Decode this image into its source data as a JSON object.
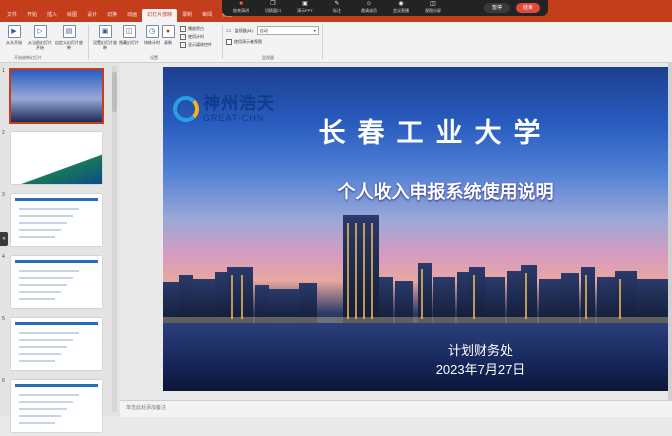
{
  "tabs": [
    "文件",
    "开始",
    "插入",
    "绘图",
    "设计",
    "切换",
    "动画",
    "幻灯片放映",
    "录制",
    "审阅",
    "视图"
  ],
  "active_tab_index": 7,
  "meeting_toolbar": {
    "items": [
      {
        "label": "结束演讲",
        "icon": "stop-icon"
      },
      {
        "label": "切换窗口",
        "icon": "window-icon"
      },
      {
        "label": "演示PPT",
        "icon": "ppt-icon"
      },
      {
        "label": "标注",
        "icon": "pen-icon"
      },
      {
        "label": "邀请成员",
        "icon": "invite-icon"
      },
      {
        "label": "会议直播",
        "icon": "live-icon"
      },
      {
        "label": "视图分屏",
        "icon": "split-icon"
      }
    ],
    "pause_label": "暂停",
    "stop_label": "结束"
  },
  "ribbon": {
    "start_group": {
      "buttons": [
        "从头开始",
        "从当前幻灯片开始",
        "自定义幻灯片放映"
      ],
      "label": "开始放映幻灯片"
    },
    "setup_group": {
      "buttons": [
        "设置幻灯片放映",
        "隐藏幻灯片",
        "排练计时",
        "录制"
      ],
      "checks": [
        {
          "label": "播放旁白",
          "checked": true
        },
        {
          "label": "使用计时",
          "checked": true
        },
        {
          "label": "显示媒体控件",
          "checked": true
        }
      ],
      "label": "设置"
    },
    "monitor_group": {
      "monitor_label": "监视器(M):",
      "monitor_value": "自动",
      "presenter_view": "使用演示者视图",
      "label": "监视器"
    }
  },
  "slides": {
    "numbers": [
      "1",
      "2",
      "3",
      "4",
      "5",
      "6"
    ],
    "selected_index": 0
  },
  "slide": {
    "logo_cn": "神州浩天",
    "logo_en": "GREAT-CHN",
    "title": "长春工业大学",
    "subtitle": "个人收入申报系统使用说明",
    "department": "计划财务处",
    "date": "2023年7月27日"
  },
  "notes_placeholder": "单击此处添加备注",
  "colors": {
    "accent": "#c43e1c",
    "toolbar": "#232323",
    "stop": "#e04a3a"
  }
}
